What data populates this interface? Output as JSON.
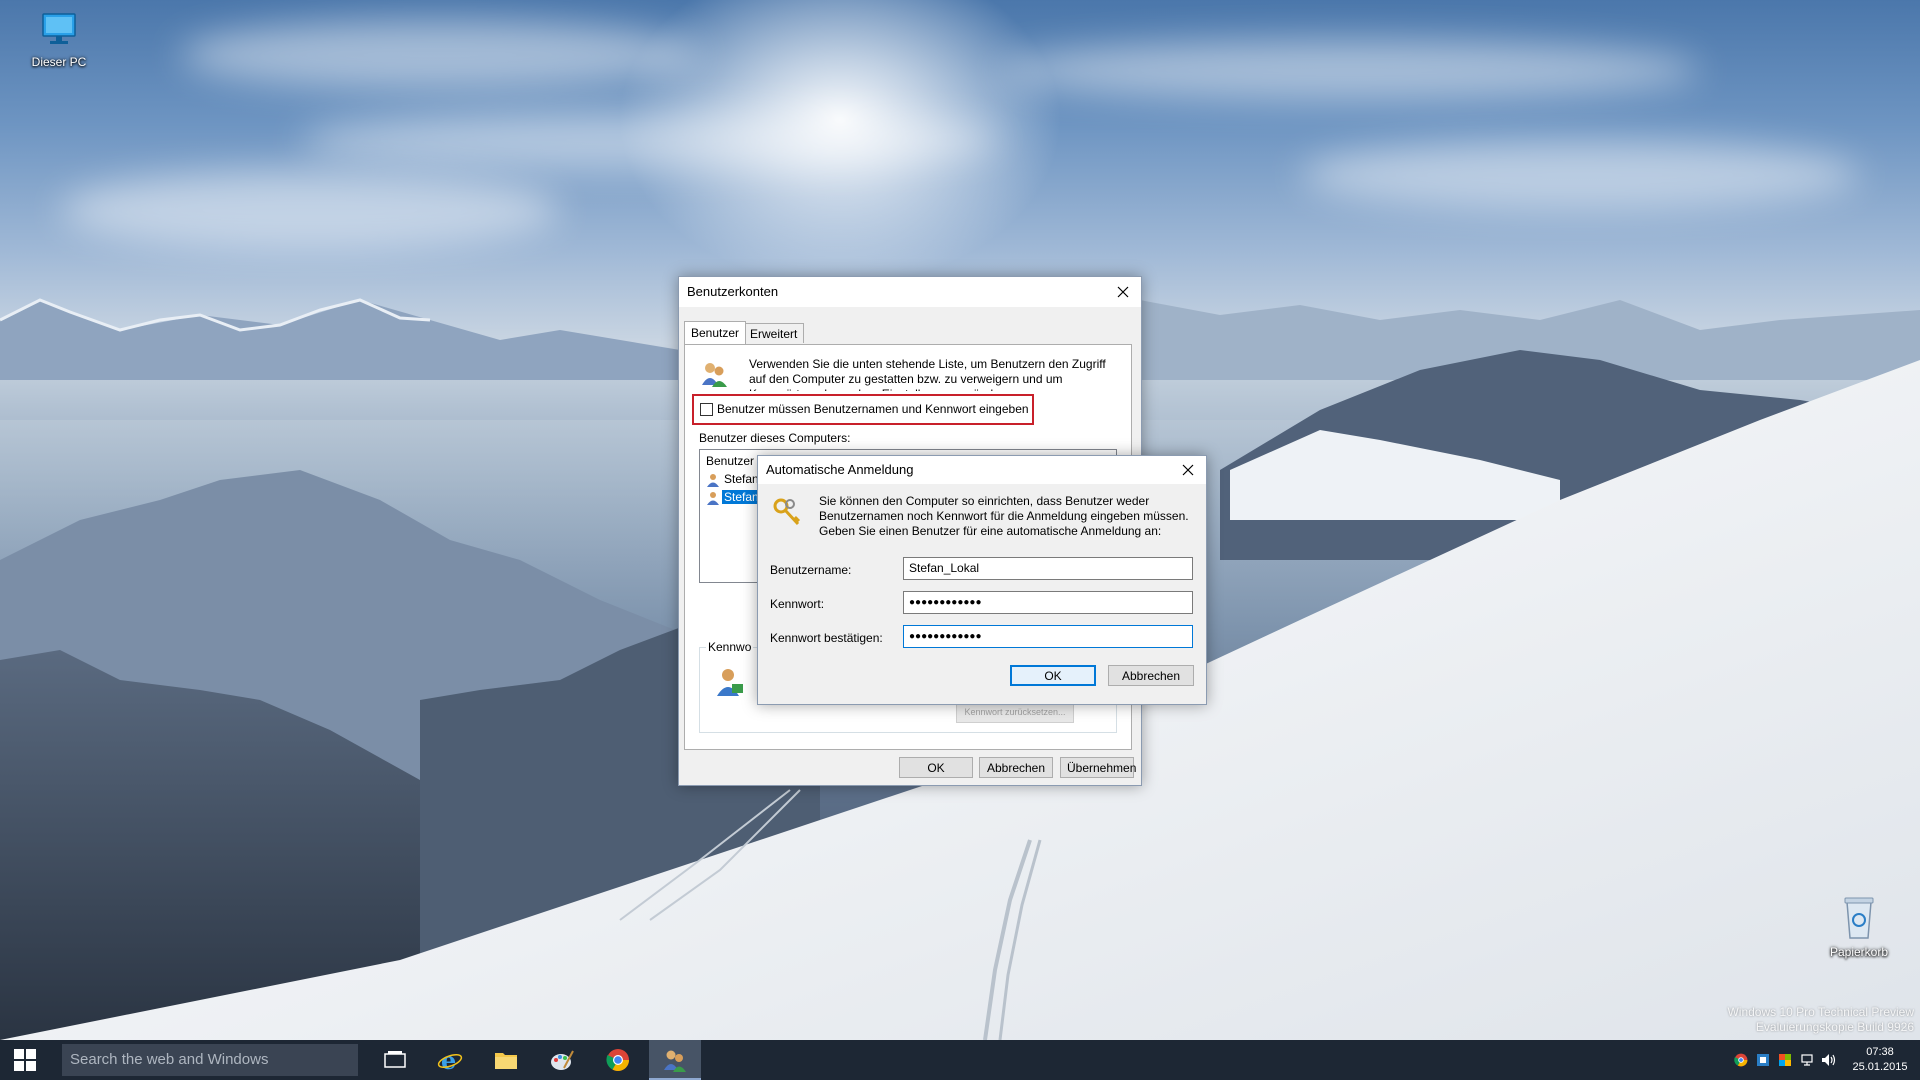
{
  "desktop": {
    "icons": [
      {
        "label": "Dieser PC",
        "icon": "computer-icon"
      },
      {
        "label": "Papierkorb",
        "icon": "recycle-bin-icon"
      }
    ],
    "watermark": {
      "line1": "Windows 10 Pro Technical Preview",
      "line2": "Evaluierungskopie Build 9926"
    }
  },
  "taskbar": {
    "search_placeholder": "Search the web and Windows",
    "apps": [
      {
        "name": "task-view",
        "icon": "task-view-icon"
      },
      {
        "name": "internet-explorer",
        "icon": "internet-explorer-icon"
      },
      {
        "name": "file-explorer",
        "icon": "folder-icon"
      },
      {
        "name": "paint",
        "icon": "paint-icon"
      },
      {
        "name": "chrome",
        "icon": "chrome-icon"
      },
      {
        "name": "user-accounts",
        "icon": "user-accounts-icon",
        "active": true
      }
    ],
    "clock": {
      "time": "07:38",
      "date": "25.01.2015"
    }
  },
  "benutzerkonten": {
    "title": "Benutzerkonten",
    "tabs": [
      {
        "label": "Benutzer",
        "active": true
      },
      {
        "label": "Erweitert",
        "active": false
      }
    ],
    "description": "Verwenden Sie die unten stehende Liste, um Benutzern den Zugriff auf den Computer zu gestatten bzw. zu verweigern und um Kennwörter oder andere Einstellungen zu ändern.",
    "checkbox_label": "Benutzer müssen Benutzernamen und Kennwort eingeben",
    "checkbox_checked": false,
    "users_label": "Benutzer dieses Computers:",
    "list_header": "Benutzer",
    "users": [
      "Stefan",
      "Stefan"
    ],
    "password_group": "Kennwo",
    "hidden_button": "Kennwort zurücksetzen...",
    "buttons": {
      "ok": "OK",
      "cancel": "Abbrechen",
      "apply": "Übernehmen"
    }
  },
  "auto_login": {
    "title": "Automatische Anmeldung",
    "description": "Sie können den Computer so einrichten, dass Benutzer weder Benutzernamen noch Kennwort für die Anmeldung eingeben müssen. Geben Sie einen Benutzer für eine automatische Anmeldung an:",
    "fields": {
      "username_label": "Benutzername:",
      "username_value": "Stefan_Lokal",
      "password_label": "Kennwort:",
      "password_value": "●●●●●●●●●●●●",
      "confirm_label": "Kennwort bestätigen:",
      "confirm_value": "●●●●●●●●●●●●"
    },
    "buttons": {
      "ok": "OK",
      "cancel": "Abbrechen"
    }
  },
  "colors": {
    "taskbar": "#1d2734",
    "accent": "#0078d7",
    "highlight": "#c8202a"
  }
}
